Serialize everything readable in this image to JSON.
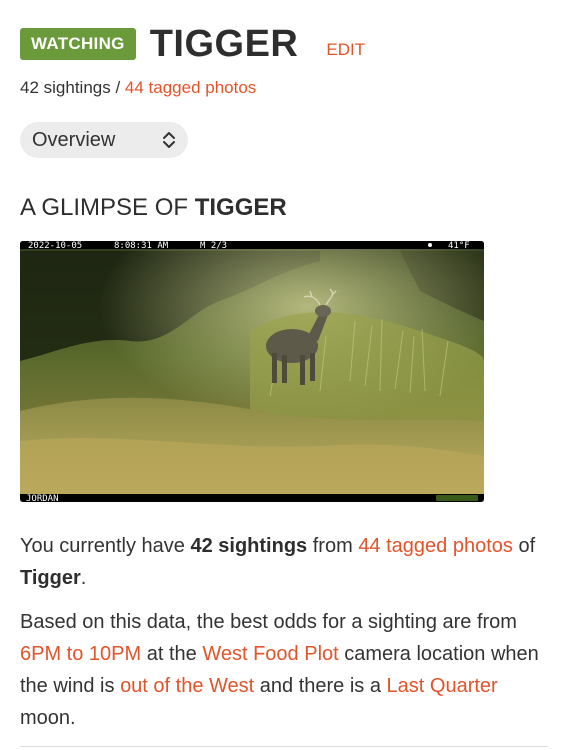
{
  "header": {
    "badge_label": "WATCHING",
    "title": "TIGGER",
    "edit_label": "EDIT"
  },
  "stats": {
    "sightings_text": "42 sightings",
    "separator": " / ",
    "tagged_photos_link": "44 tagged photos"
  },
  "view_select": {
    "selected": "Overview"
  },
  "section": {
    "heading_prefix": "A GLIMPSE OF ",
    "heading_name": "TIGGER"
  },
  "photo": {
    "date": "2022-10-05",
    "time": "8:08:31 AM",
    "moon": "M 2/3",
    "temperature": "41°F",
    "camera_name": "JORDAN"
  },
  "summary": {
    "p1_a": "You currently have ",
    "p1_b": "42 sightings",
    "p1_c": " from ",
    "p1_link": "44 tagged photos",
    "p1_d": " of ",
    "p1_e": "Tigger",
    "p1_f": ".",
    "p2_a": "Based on this data, the best odds for a sighting are from ",
    "p2_time": "6PM to 10PM",
    "p2_b": " at the ",
    "p2_location": "West Food Plot",
    "p2_c": " camera location when the wind is ",
    "p2_wind": "out of the West",
    "p2_d": " and there is a ",
    "p2_moon": "Last Quarter",
    "p2_e": " moon."
  },
  "colors": {
    "accent": "#e2542a",
    "badge": "#6a9a3a"
  }
}
